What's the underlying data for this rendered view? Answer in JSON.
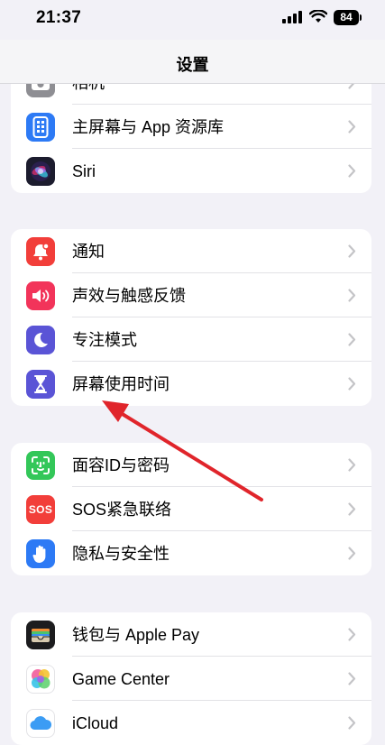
{
  "status_bar": {
    "time": "21:37",
    "battery": "84"
  },
  "nav": {
    "title": "设置"
  },
  "groups": [
    {
      "rows": [
        {
          "label": "相机",
          "icon": "camera-icon",
          "color": "#8e8e93"
        },
        {
          "label": "主屏幕与 App 资源库",
          "icon": "home-screen-icon",
          "color": "#2d7af5"
        },
        {
          "label": "Siri",
          "icon": "siri-icon",
          "color": "#1c1c2e"
        }
      ]
    },
    {
      "rows": [
        {
          "label": "通知",
          "icon": "notification-bell-icon",
          "color": "#f23e3a"
        },
        {
          "label": "声效与触感反馈",
          "icon": "speaker-icon",
          "color": "#f2345a"
        },
        {
          "label": "专注模式",
          "icon": "moon-icon",
          "color": "#5a54d6"
        },
        {
          "label": "屏幕使用时间",
          "icon": "hourglass-icon",
          "color": "#5a54d6"
        }
      ]
    },
    {
      "rows": [
        {
          "label": "面容ID与密码",
          "icon": "face-id-icon",
          "color": "#33c759"
        },
        {
          "label": "SOS紧急联络",
          "icon": "sos-icon",
          "icon_text": "SOS",
          "color": "#f23e3a"
        },
        {
          "label": "隐私与安全性",
          "icon": "hand-icon",
          "color": "#2d7af5"
        }
      ]
    },
    {
      "rows": [
        {
          "label": "钱包与 Apple Pay",
          "icon": "wallet-icon",
          "color": "#1c1c1e"
        },
        {
          "label": "Game Center",
          "icon": "game-center-icon",
          "color": "#ffffff"
        },
        {
          "label": "iCloud",
          "icon": "icloud-icon",
          "color": "#ffffff"
        }
      ]
    }
  ],
  "annotation": {
    "arrow_color": "#e0252b"
  }
}
